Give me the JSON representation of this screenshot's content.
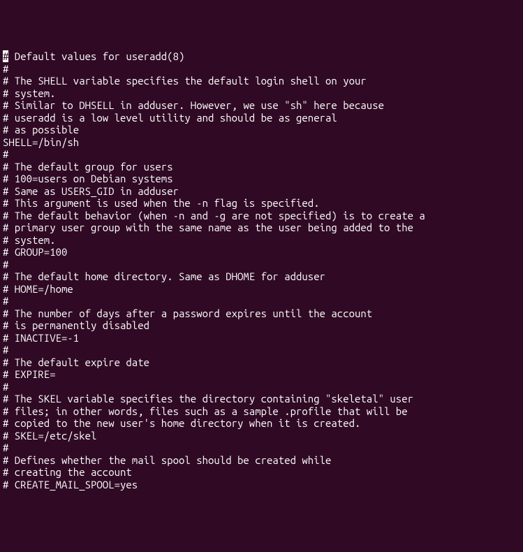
{
  "terminal": {
    "bg": "#300a24",
    "fg": "#ffffff",
    "cursor_char": "#",
    "lines": [
      " Default values for useradd(8)",
      "#",
      "# The SHELL variable specifies the default login shell on your",
      "# system.",
      "# Similar to DHSELL in adduser. However, we use \"sh\" here because",
      "# useradd is a low level utility and should be as general",
      "# as possible",
      "SHELL=/bin/sh",
      "#",
      "# The default group for users",
      "# 100=users on Debian systems",
      "# Same as USERS_GID in adduser",
      "# This argument is used when the -n flag is specified.",
      "# The default behavior (when -n and -g are not specified) is to create a",
      "# primary user group with the same name as the user being added to the",
      "# system.",
      "# GROUP=100",
      "#",
      "# The default home directory. Same as DHOME for adduser",
      "# HOME=/home",
      "#",
      "# The number of days after a password expires until the account",
      "# is permanently disabled",
      "# INACTIVE=-1",
      "#",
      "# The default expire date",
      "# EXPIRE=",
      "#",
      "# The SKEL variable specifies the directory containing \"skeletal\" user",
      "# files; in other words, files such as a sample .profile that will be",
      "# copied to the new user's home directory when it is created.",
      "# SKEL=/etc/skel",
      "#",
      "# Defines whether the mail spool should be created while",
      "# creating the account",
      "# CREATE_MAIL_SPOOL=yes"
    ]
  }
}
